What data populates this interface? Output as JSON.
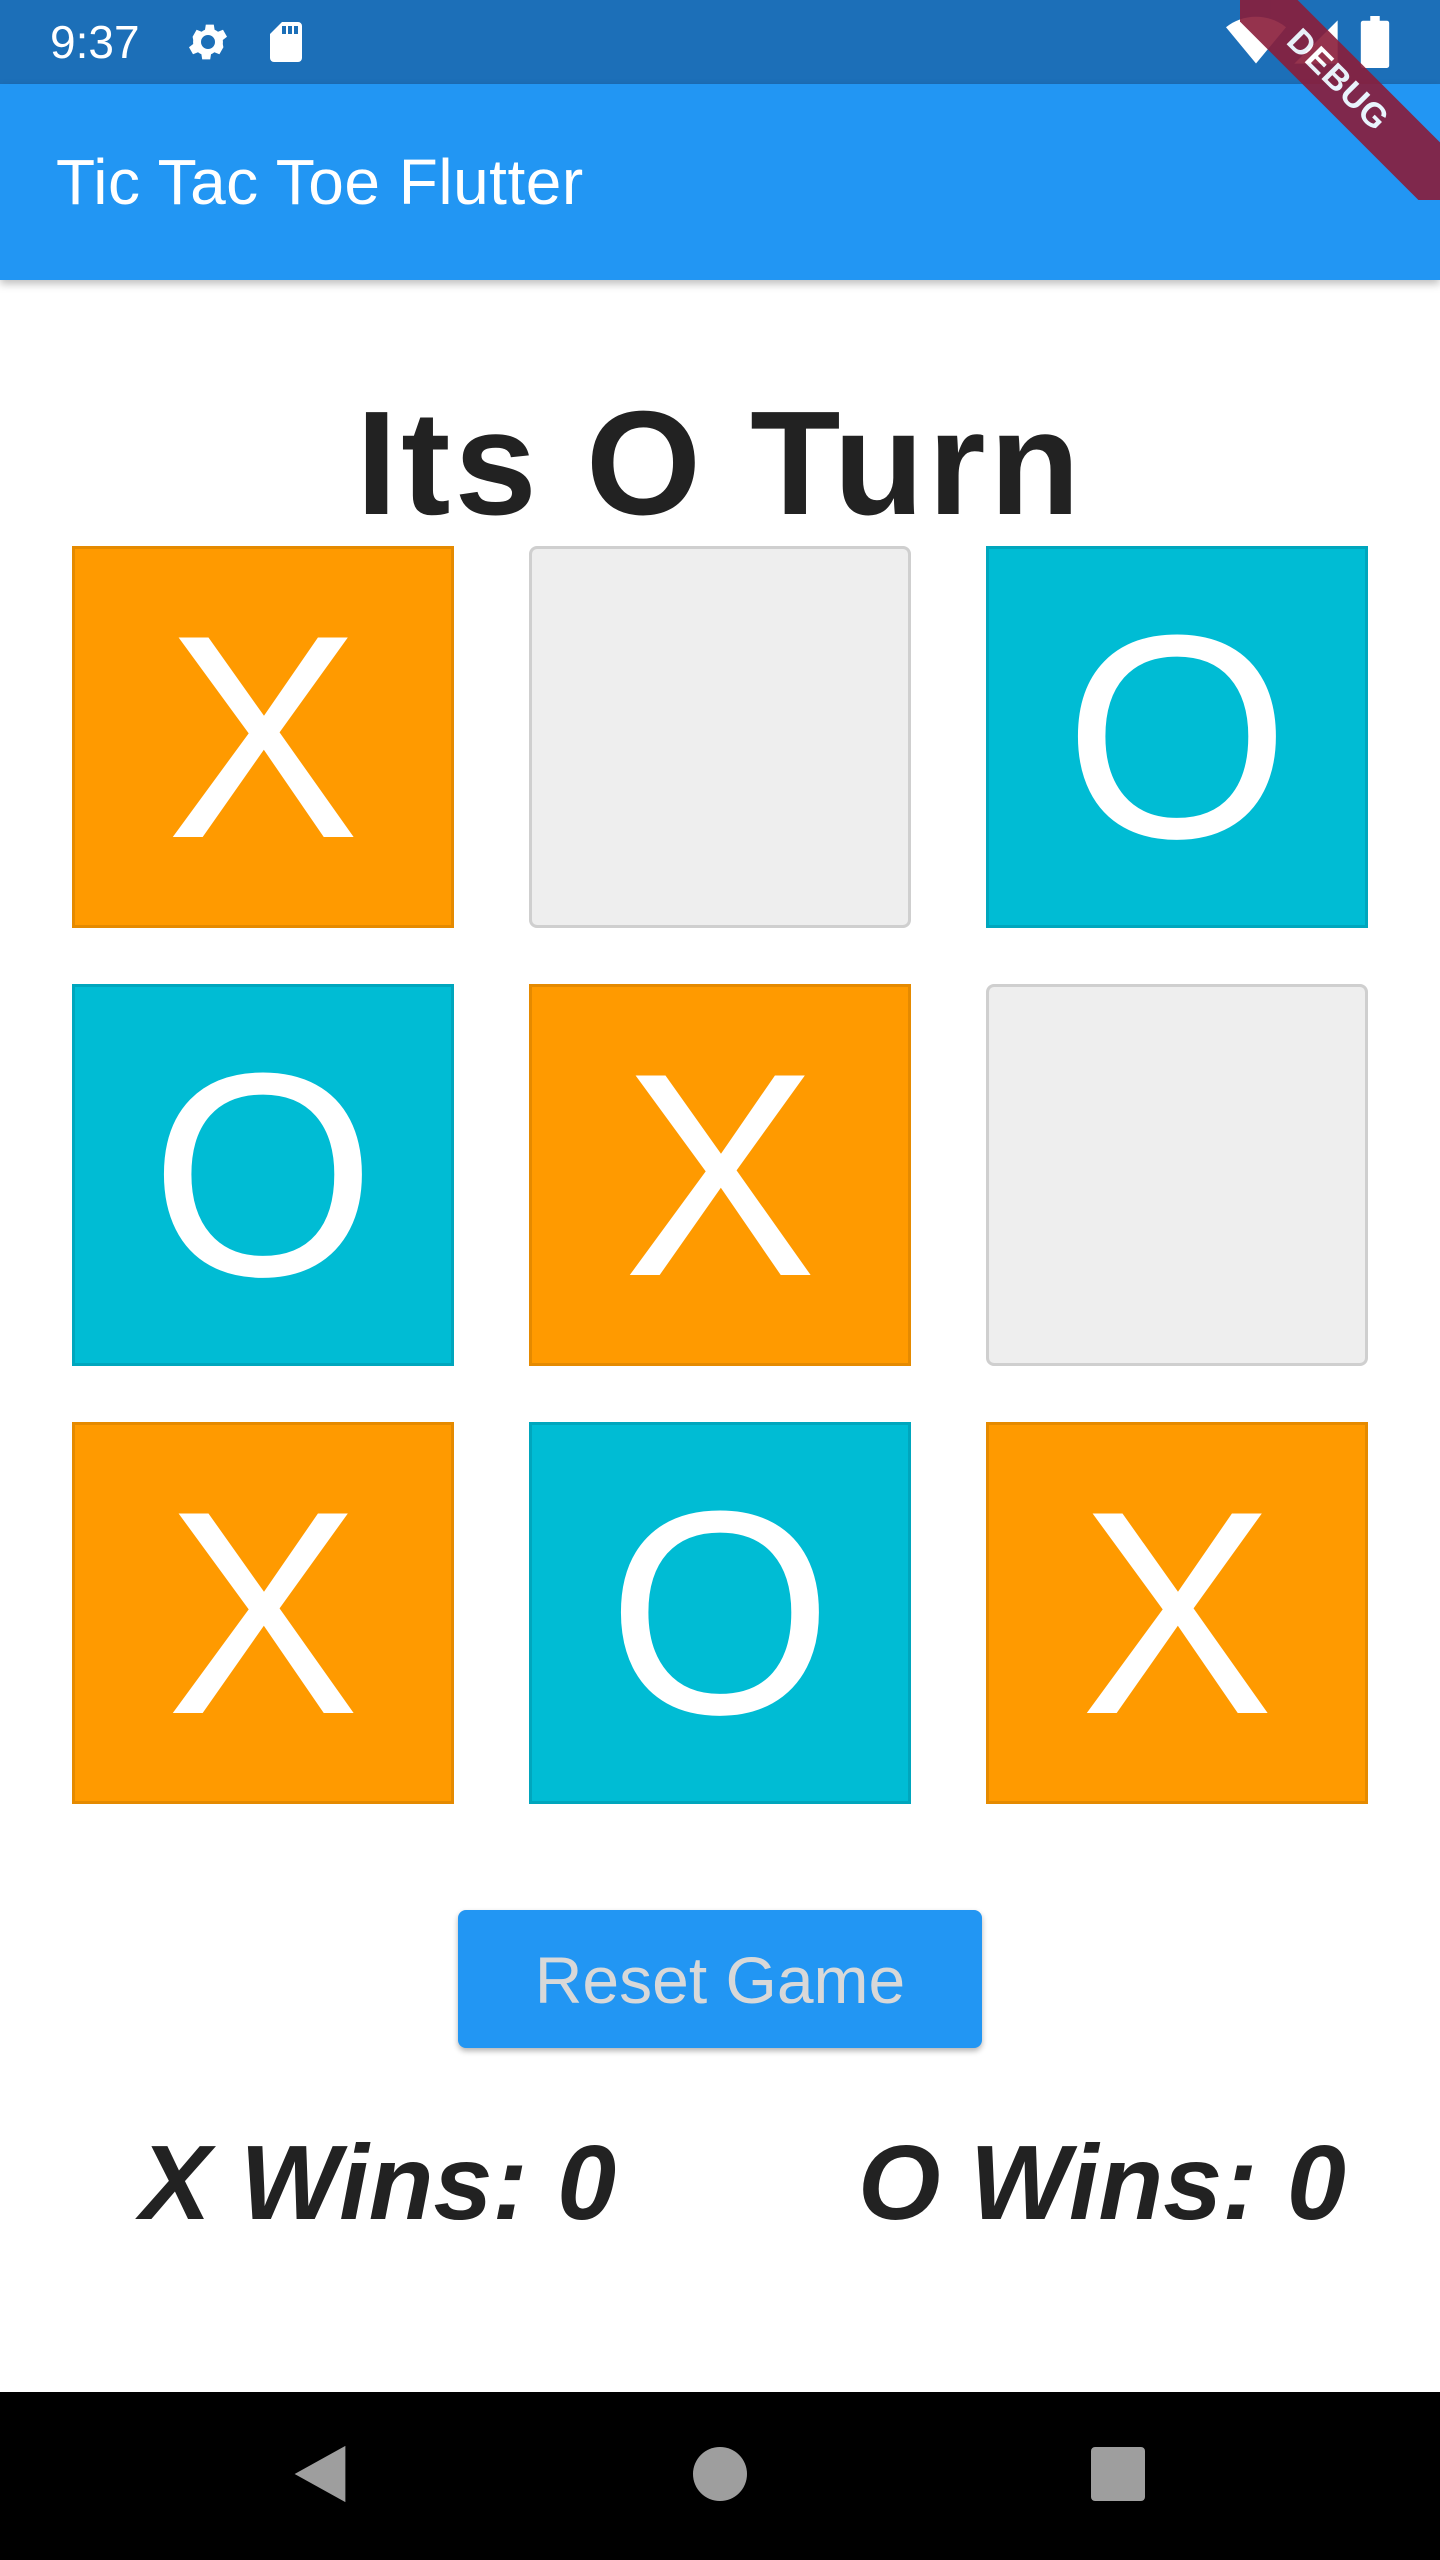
{
  "status_bar": {
    "time": "9:37",
    "icons": [
      "gear-icon",
      "sd-card-icon",
      "wifi-icon",
      "signal-icon",
      "battery-icon"
    ]
  },
  "app_bar": {
    "title": "Tic Tac Toe Flutter",
    "debug_label": "DEBUG"
  },
  "game": {
    "turn_text": "Its O Turn",
    "board": [
      [
        "X",
        "",
        "O"
      ],
      [
        "O",
        "X",
        ""
      ],
      [
        "X",
        "O",
        "X"
      ]
    ],
    "reset_label": "Reset Game",
    "x_wins": "X Wins: 0",
    "o_wins": "O Wins: 0"
  },
  "colors": {
    "x_tile": "#ff9a00",
    "o_tile": "#00bcd4",
    "empty_tile": "#eeeeee",
    "app_bar": "#2296f3",
    "status_bar": "#1c6fb8"
  },
  "nav_bar": {
    "icons": [
      "back-icon",
      "home-icon",
      "recents-icon"
    ]
  }
}
